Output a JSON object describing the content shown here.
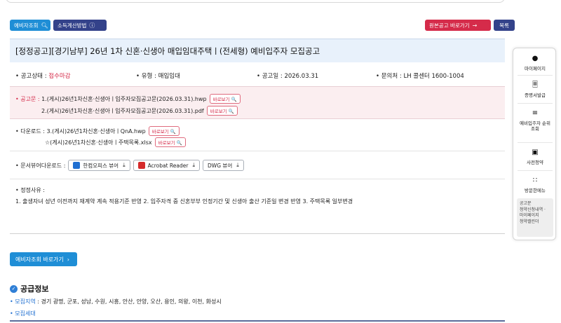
{
  "toolbar": {
    "pre_search_label": "예비자조회",
    "income_calc_label": "소득계산방법",
    "original_notice_label": "원본공고 바로가기",
    "list_label": "목록"
  },
  "title": "[정정공고][경기남부] 26년 1차 신혼·신생아 매입임대주택ㅣ(전세형) 예비입주자 모집공고",
  "info": {
    "status_label": "공고상태 :",
    "status_value": "접수마감",
    "type_label": "유형 :",
    "type_value": "매입임대",
    "date_label": "공고일 :",
    "date_value": "2026.03.31",
    "contact_label": "문의처 :",
    "contact_value": "LH 콜센터 1600-1004"
  },
  "notice": {
    "label": "공고문 :",
    "files": [
      "1.(게시)26년1차신혼·신생아ㅣ입주자모집공고문(2026.03.31).hwp",
      "2.(게시)26년1차신혼·신생아ㅣ입주자모집공고문(2026.03.31).pdf"
    ],
    "view_label": "바로보기 🔍"
  },
  "downloads": {
    "label": "다운로드 :",
    "files": [
      "3.(게시)26년1차신혼·신생아ㅣQnA.hwp",
      "☆(게시)26년1차신혼·신생아ㅣ주택목록.xlsx"
    ],
    "view_label": "바로보기 🔍"
  },
  "viewers": {
    "label": "문서뷰어다운로드 :",
    "items": [
      "한컴오피스 뷰어",
      "Acrobat Reader",
      "DWG 뷰어"
    ]
  },
  "reason": {
    "label": "정정사유 :",
    "text": "1. 출생자녀 성년 이전까지 재계약 계속 적용기준 반영 2. 입주자격 중 신혼부부 인정기간 및 신생아 출산 기준일 변경 반영 3. 주택목록 일부변경"
  },
  "pre_search_link": "예비자조회 바로가기",
  "supply": {
    "title": "공급정보",
    "region_label": "모집지역",
    "region_value": " : 경기 광명, 군포, 성남, 수원, 시흥, 안산, 안양, 오산, 용인, 의왕, 이천, 화성시",
    "household_label": "모집세대"
  },
  "quick_menu": {
    "items": [
      "마이페이지",
      "증명서발급",
      "예비입주자 순위 조회",
      "사전청약",
      "방문한메뉴"
    ],
    "visited": [
      "공고문",
      "청약신청내역 ·",
      "마이페이지",
      "청약캘린더"
    ]
  },
  "colors": {
    "accent_blue": "#1f8ed6",
    "navy": "#33428a",
    "red": "#d52b4a",
    "title_bg": "#e8f1fb",
    "notice_bg": "#fbeef0"
  },
  "icons": [
    "search-icon",
    "info-icon",
    "arrow-right-icon",
    "download-icon",
    "user-icon",
    "document-icon",
    "list-icon",
    "calendar-icon",
    "grid-icon",
    "check-circle-icon"
  ]
}
